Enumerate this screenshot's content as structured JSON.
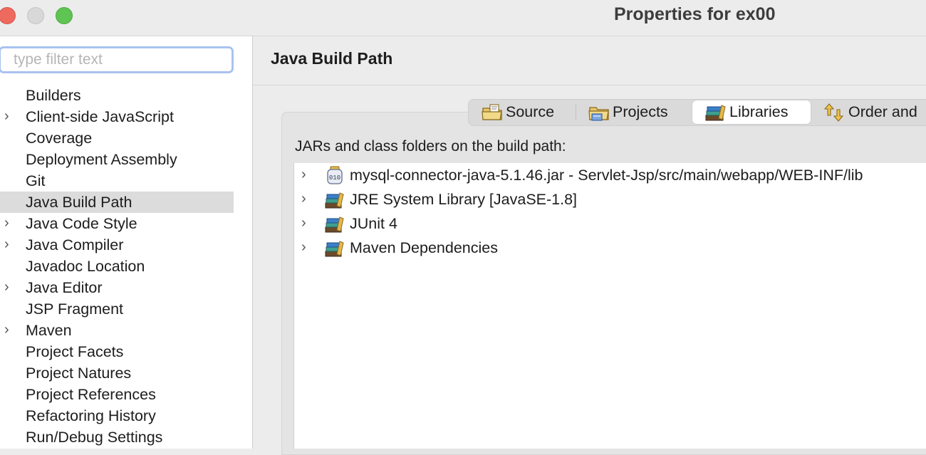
{
  "window": {
    "title": "Properties for ex00"
  },
  "sidebar": {
    "filter_placeholder": "type filter text",
    "items": [
      {
        "label": "Builders",
        "expandable": false
      },
      {
        "label": "Client-side JavaScript",
        "expandable": true
      },
      {
        "label": "Coverage",
        "expandable": false
      },
      {
        "label": "Deployment Assembly",
        "expandable": false
      },
      {
        "label": "Git",
        "expandable": false
      },
      {
        "label": "Java Build Path",
        "expandable": false,
        "selected": true
      },
      {
        "label": "Java Code Style",
        "expandable": true
      },
      {
        "label": "Java Compiler",
        "expandable": true
      },
      {
        "label": "Javadoc Location",
        "expandable": false
      },
      {
        "label": "Java Editor",
        "expandable": true
      },
      {
        "label": "JSP Fragment",
        "expandable": false
      },
      {
        "label": "Maven",
        "expandable": true
      },
      {
        "label": "Project Facets",
        "expandable": false
      },
      {
        "label": "Project Natures",
        "expandable": false
      },
      {
        "label": "Project References",
        "expandable": false
      },
      {
        "label": "Refactoring History",
        "expandable": false
      },
      {
        "label": "Run/Debug Settings",
        "expandable": false
      }
    ]
  },
  "main": {
    "title": "Java Build Path",
    "tabs": [
      {
        "label": "Source",
        "icon": "source-folder-icon"
      },
      {
        "label": "Projects",
        "icon": "projects-folder-icon"
      },
      {
        "label": "Libraries",
        "icon": "libraries-icon",
        "active": true
      },
      {
        "label": "Order and",
        "icon": "order-arrows-icon"
      }
    ],
    "content_label": "JARs and class folders on the build path:",
    "libraries": [
      {
        "label": "mysql-connector-java-5.1.46.jar - Servlet-Jsp/src/main/webapp/WEB-INF/lib",
        "icon": "jar-file-icon"
      },
      {
        "label": "JRE System Library [JavaSE-1.8]",
        "icon": "library-icon"
      },
      {
        "label": "JUnit 4",
        "icon": "library-icon"
      },
      {
        "label": "Maven Dependencies",
        "icon": "library-icon"
      }
    ]
  },
  "colors": {
    "selection": "#dcdcdc",
    "focus_ring": "#a9c2ef",
    "close": "#ee6a5f",
    "maximize": "#5fc454"
  }
}
